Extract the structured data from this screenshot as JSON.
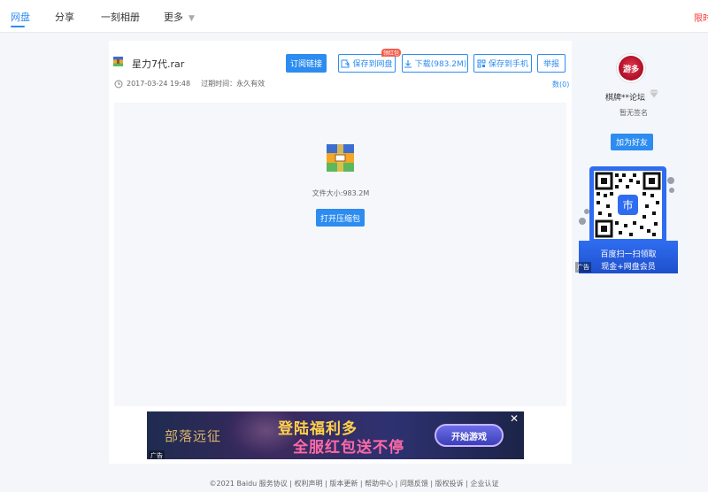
{
  "nav": {
    "items": [
      "网盘",
      "分享",
      "一刻相册",
      "更多"
    ],
    "right_link": "限时"
  },
  "file": {
    "name": "星力7代.rar",
    "date": "2017-03-24 19:48",
    "expire": "过期时间：永久有效",
    "comments": "数(0)",
    "size_label": "文件大小:983.2M"
  },
  "toolbar": {
    "subscribe": "订阅链接",
    "save_netdisk": "保存到网盘",
    "save_badge": "领红包",
    "download": "下载(983.2M)",
    "save_phone": "保存到手机",
    "report": "举报"
  },
  "preview": {
    "open_button": "打开压缩包"
  },
  "banner": {
    "left_title": "部落远征",
    "line1": "登陆福利多",
    "line2": "全服红包送不停",
    "play_button": "开始游戏",
    "close": "✕",
    "ad_tag": "广告"
  },
  "sidebar": {
    "avatar_text": "游多",
    "username": "棋牌**论坛",
    "signature": "暂无签名",
    "add_friend": "加为好友",
    "qr_icon_text": "巿",
    "qr_line1": "百度扫一扫领取",
    "qr_line2": "现金+网盘会员",
    "ad_tag": "广告"
  },
  "footer": {
    "text": "©2021 Baidu  服务协议 | 权利声明 | 版本更新 | 帮助中心 | 问题反馈 | 版权投诉 | 企业认证"
  },
  "colors": {
    "accent": "#2d8cf0",
    "badge": "#f25c4c",
    "qr_blue": "#2f6df0"
  }
}
